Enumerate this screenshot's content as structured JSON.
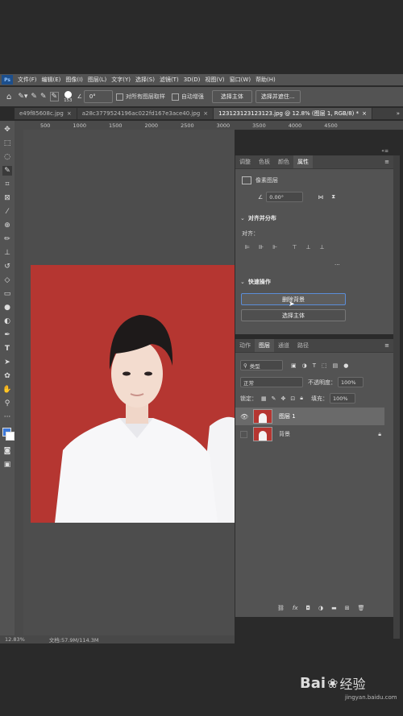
{
  "menu": {
    "logo": "Ps",
    "items": [
      "文件(F)",
      "编辑(E)",
      "图像(I)",
      "图层(L)",
      "文字(Y)",
      "选择(S)",
      "滤镜(T)",
      "3D(D)",
      "视图(V)",
      "窗口(W)",
      "帮助(H)"
    ]
  },
  "options": {
    "brush_size": "153",
    "angle": "0°",
    "sample_all_layers": "对所有图层取样",
    "auto_enhance": "自动增强",
    "select_subject": "选择主体",
    "select_and_mask": "选择并遮住..."
  },
  "tabs": [
    {
      "label": "e49f85608c.jpg",
      "close": "×"
    },
    {
      "label": "a28c3779524196ac022fd167e3ace40.jpg",
      "close": "×"
    },
    {
      "label": "123123123123123.jpg @ 12.8% (图层 1, RGB/8) *",
      "close": "×"
    }
  ],
  "ruler": {
    "ticks": [
      "500",
      "1000",
      "1500",
      "2000",
      "2500",
      "3000",
      "3500",
      "4000",
      "4500"
    ]
  },
  "properties": {
    "tabs": [
      "调整",
      "色板",
      "颜色",
      "属性"
    ],
    "active_tab": "属性",
    "type_label": "像素图层",
    "angle_value": "0.00°",
    "align_section": "对齐并分布",
    "align_label": "对齐：",
    "more": "...",
    "quick_actions": "快速操作",
    "remove_bg": "删除背景",
    "select_subject": "选择主体"
  },
  "layers": {
    "tabs": [
      "动作",
      "图层",
      "通道",
      "路径"
    ],
    "active_tab": "图层",
    "filter_kind": "类型",
    "blend_mode": "正常",
    "opacity_label": "不透明度：",
    "opacity_value": "100%",
    "lock_label": "锁定：",
    "fill_label": "填充：",
    "fill_value": "100%",
    "items": [
      {
        "name": "图层 1",
        "selected": true,
        "visible": true
      },
      {
        "name": "背景",
        "selected": false,
        "visible": false,
        "locked": true
      }
    ]
  },
  "status": {
    "zoom": "12.83%",
    "doc": "文档:57.9M/114.3M"
  },
  "watermark": {
    "brand": "Bai",
    "product": "经验",
    "url": "jingyan.baidu.com"
  },
  "colors": {
    "photo_bg": "#b53631",
    "accent": "#5b8dd8",
    "foreground": "#3c78d8"
  }
}
